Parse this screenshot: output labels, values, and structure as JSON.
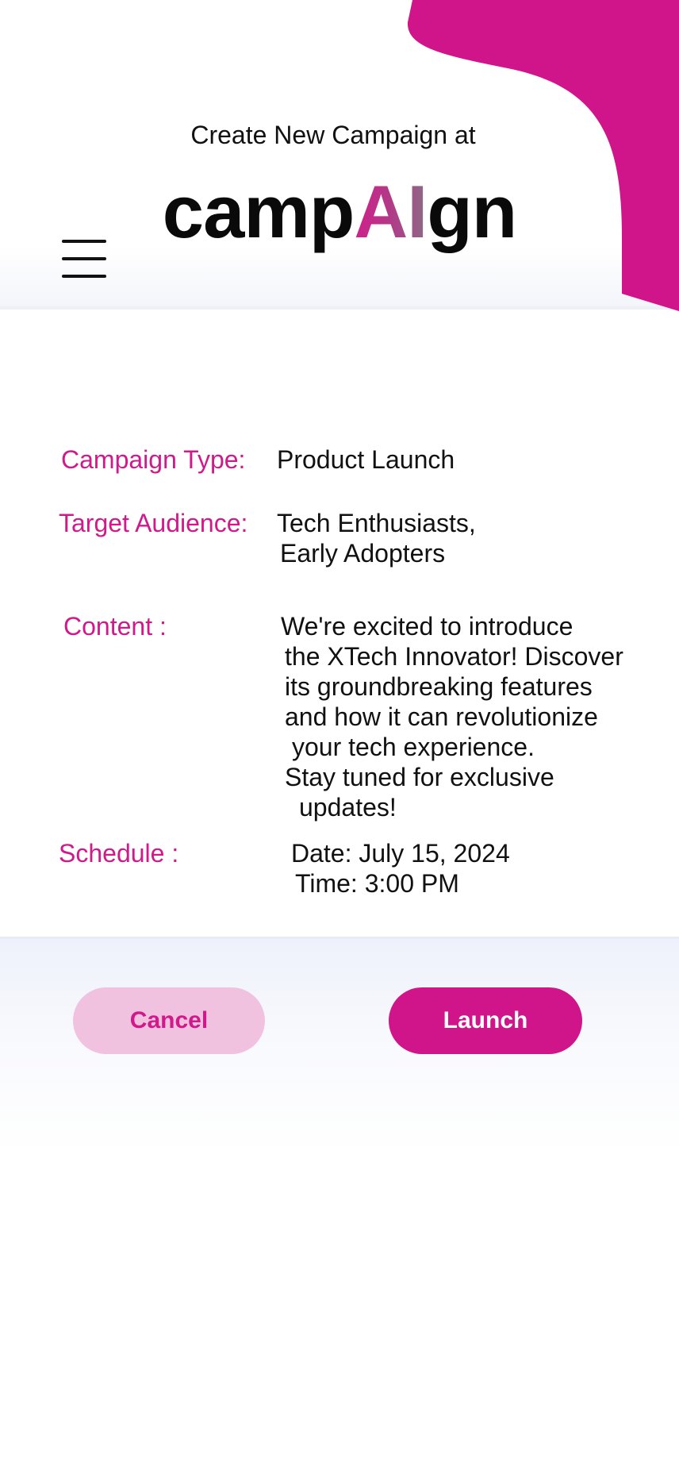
{
  "header": {
    "subtitle": "Create New Campaign at",
    "logo": {
      "part1": "camp",
      "part2": "AI",
      "part3": "gn"
    }
  },
  "details": {
    "campaign_type": {
      "label": "Campaign Type:",
      "value": "Product Launch"
    },
    "target_audience": {
      "label": "Target Audience:",
      "lines": [
        "Tech Enthusiasts,",
        "Early Adopters"
      ]
    },
    "content": {
      "label": "Content :",
      "lines": [
        "We're excited to introduce",
        "the XTech Innovator! Discover",
        "its groundbreaking features",
        "and how it can revolutionize",
        "your tech experience.",
        "Stay tuned for exclusive",
        "updates!"
      ]
    },
    "schedule": {
      "label": "Schedule :",
      "lines": [
        "Date: July 15, 2024",
        "Time: 3:00 PM"
      ]
    }
  },
  "actions": {
    "cancel_label": "Cancel",
    "launch_label": "Launch"
  },
  "colors": {
    "accent": "#d0148a",
    "accent_light": "#f1c1e0",
    "text": "#111111"
  },
  "icons": {
    "menu": "hamburger-menu-icon"
  }
}
